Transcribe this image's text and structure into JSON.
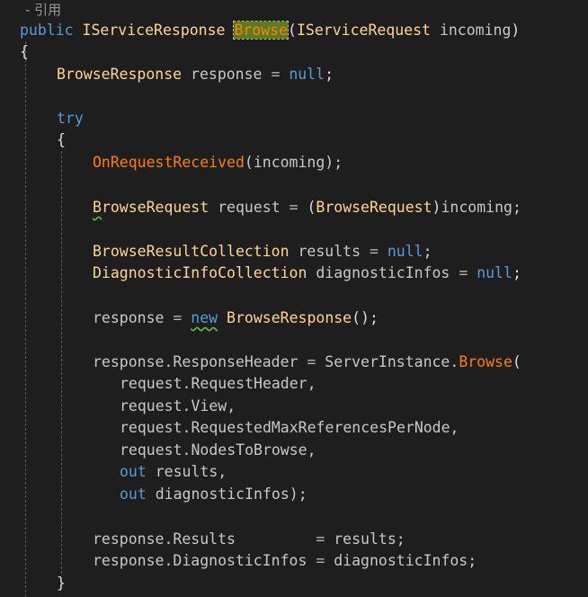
{
  "codelens": {
    "text": "- 引用"
  },
  "code": {
    "l1": {
      "kw": "public",
      "type": "IServiceResponse",
      "method": "Browse",
      "paren": "(",
      "ptype": "IServiceRequest",
      "pname": "incoming",
      "close": ")"
    },
    "l2": {
      "brace": "{"
    },
    "l3": {
      "type": "BrowseResponse",
      "var": "response",
      "eq": "=",
      "nul": "null",
      "semi": ";"
    },
    "l4": {
      "kw": "try"
    },
    "l5": {
      "brace": "{"
    },
    "l6": {
      "fn": "OnRequestReceived",
      "args": "(incoming);"
    },
    "l7": {
      "type_first": "B",
      "type_rest": "rowseRequest",
      "var": "request",
      "eq": "=",
      "cast_open": "(",
      "cast_type": "BrowseRequest",
      "cast_close": ")",
      "rest": "incoming;"
    },
    "l8": {
      "type": "BrowseResultCollection",
      "var": "results",
      "eq": "=",
      "nul": "null",
      "semi": ";"
    },
    "l9": {
      "type": "DiagnosticInfoCollection",
      "var": "diagnosticInfos",
      "eq": "=",
      "nul": "null",
      "semi": ";"
    },
    "l10": {
      "var": "response",
      "eq": "=",
      "kw": "new",
      "type": "BrowseResponse",
      "rest": "();"
    },
    "l11": {
      "lhs": "response.ResponseHeader",
      "eq": "=",
      "obj": "ServerInstance.",
      "fn": "Browse",
      "paren": "("
    },
    "l12": {
      "text": "request.RequestHeader,"
    },
    "l13": {
      "text": "request.View,"
    },
    "l14": {
      "text": "request.RequestedMaxReferencesPerNode,"
    },
    "l15": {
      "text": "request.NodesToBrowse,"
    },
    "l16": {
      "kw": "out",
      "text": "results,"
    },
    "l17": {
      "kw": "out",
      "text": "diagnosticInfos);"
    },
    "l18": {
      "lhs": "response.Results",
      "eq": "=",
      "rhs": "results;"
    },
    "l19": {
      "lhs": "response.DiagnosticInfos",
      "eq": "=",
      "rhs": "diagnosticInfos;"
    },
    "l20": {
      "brace": "}"
    }
  }
}
